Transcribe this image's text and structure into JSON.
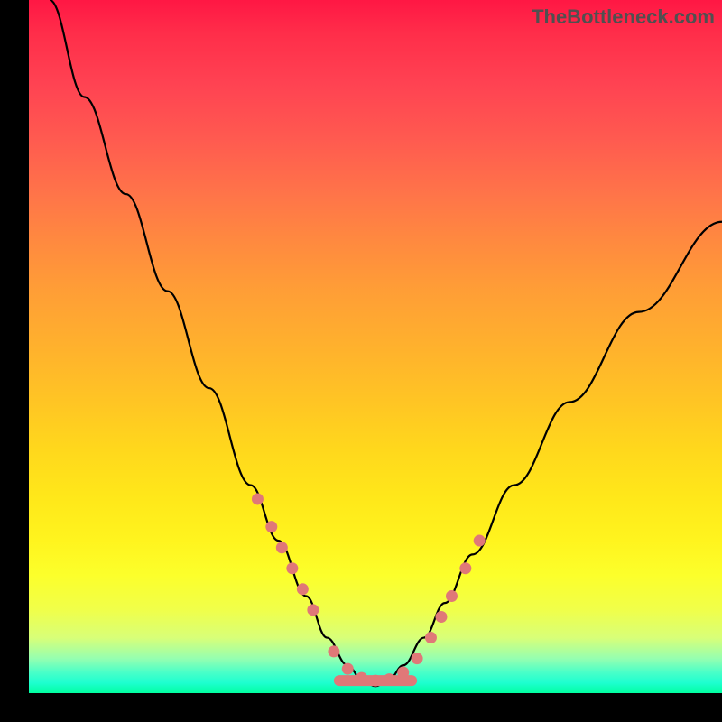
{
  "watermark": "TheBottleneck.com",
  "chart_data": {
    "type": "line",
    "title": "",
    "xlabel": "",
    "ylabel": "",
    "xlim": [
      0,
      100
    ],
    "ylim": [
      0,
      100
    ],
    "series": [
      {
        "name": "bottleneck-curve",
        "x": [
          3,
          8,
          14,
          20,
          26,
          32,
          36,
          40,
          43,
          46,
          48,
          50,
          52,
          54,
          57,
          60,
          64,
          70,
          78,
          88,
          100
        ],
        "y": [
          100,
          86,
          72,
          58,
          44,
          30,
          22,
          14,
          8,
          4,
          2,
          1,
          2,
          4,
          8,
          13,
          20,
          30,
          42,
          55,
          68
        ]
      }
    ],
    "markers": {
      "name": "highlight-points",
      "color": "#e07878",
      "x": [
        33,
        35,
        36.5,
        38,
        39.5,
        41,
        44,
        46,
        48,
        50,
        52,
        54,
        56,
        58,
        59.5,
        61,
        63,
        65
      ],
      "y": [
        28,
        24,
        21,
        18,
        15,
        12,
        6,
        3.5,
        2.2,
        1.8,
        2,
        3,
        5,
        8,
        11,
        14,
        18,
        22
      ]
    },
    "trough_band": {
      "x_start": 44,
      "x_end": 56,
      "y": 1.8,
      "color": "#e07878"
    }
  }
}
